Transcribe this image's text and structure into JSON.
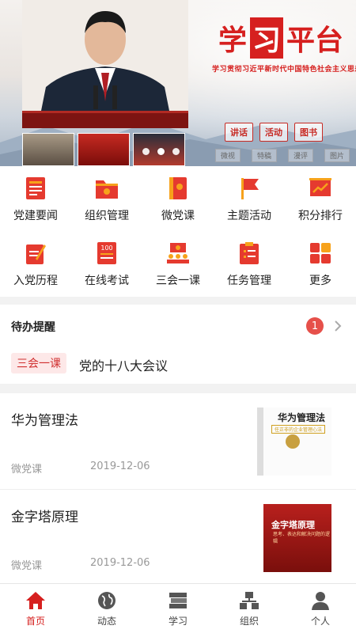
{
  "banner": {
    "brand_title": [
      "学",
      "习",
      "平台"
    ],
    "brand_subtitle": "学习贯彻习近平新时代中国特色社会主义思想",
    "pills": [
      "讲话",
      "活动",
      "图书"
    ],
    "tags": [
      "微视",
      "特稿",
      "漫评",
      "图片"
    ]
  },
  "menu": {
    "items": [
      {
        "label": "党建要闻",
        "icon": "news-icon"
      },
      {
        "label": "组织管理",
        "icon": "folder-icon"
      },
      {
        "label": "微党课",
        "icon": "book-icon"
      },
      {
        "label": "主题活动",
        "icon": "flag-icon"
      },
      {
        "label": "积分排行",
        "icon": "chart-icon"
      },
      {
        "label": "入党历程",
        "icon": "pen-note-icon"
      },
      {
        "label": "在线考试",
        "icon": "exam-icon"
      },
      {
        "label": "三会一课",
        "icon": "meeting-icon"
      },
      {
        "label": "任务管理",
        "icon": "task-icon"
      },
      {
        "label": "更多",
        "icon": "grid-icon"
      }
    ]
  },
  "todo": {
    "heading": "待办提醒",
    "count": "1",
    "tag": "三会一课",
    "text": "党的十八大会议"
  },
  "articles": [
    {
      "title": "华为管理法",
      "category": "微党课",
      "date": "2019-12-06",
      "cover_title": "华为管理法",
      "cover_sub": "任正非的企业管理心法"
    },
    {
      "title": "金字塔原理",
      "category": "微党课",
      "date": "2019-12-06",
      "cover_title": "金字塔原理",
      "cover_sub": "思考、表达和解决问题的逻辑"
    }
  ],
  "tabbar": {
    "tabs": [
      {
        "label": "首页",
        "icon": "home-icon",
        "active": true
      },
      {
        "label": "动态",
        "icon": "globe-icon",
        "active": false
      },
      {
        "label": "学习",
        "icon": "books-icon",
        "active": false
      },
      {
        "label": "组织",
        "icon": "org-icon",
        "active": false
      },
      {
        "label": "个人",
        "icon": "person-icon",
        "active": false
      }
    ]
  },
  "colors": {
    "accent": "#d6201f",
    "badge": "#e6504a",
    "icon_red": "#e53a2f",
    "icon_orange": "#f7a21b"
  }
}
